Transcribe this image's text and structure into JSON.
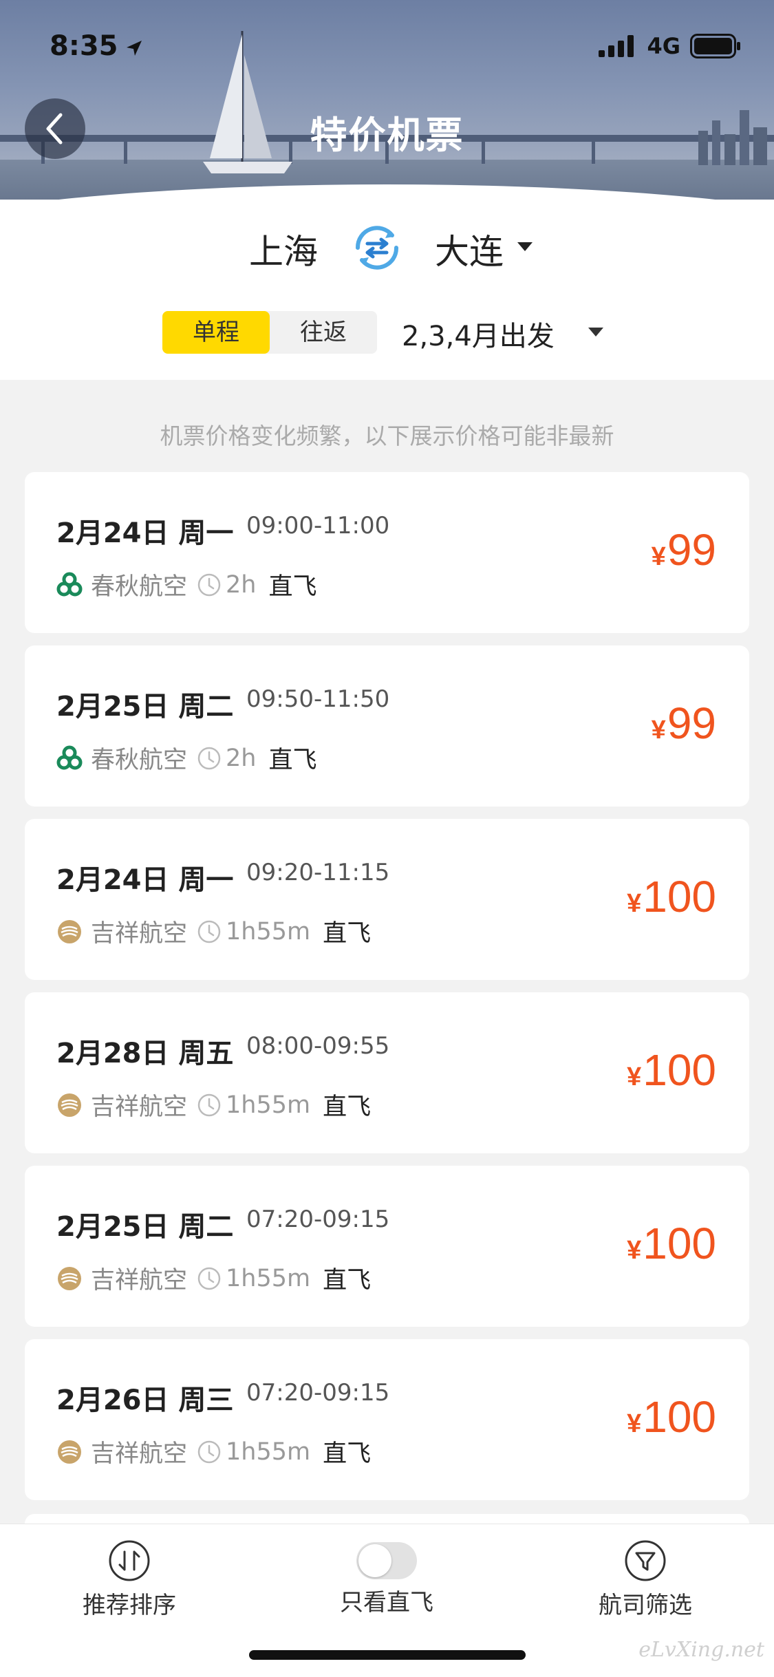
{
  "status_bar": {
    "time": "8:35",
    "network": "4G"
  },
  "header": {
    "title": "特价机票"
  },
  "route": {
    "from_city": "上海",
    "to_city": "大连"
  },
  "trip_type": {
    "one_way": "单程",
    "round_trip": "往返",
    "selected": "单程"
  },
  "departure_months": "2,3,4月出发",
  "notice": "机票价格变化频繁，以下展示价格可能非最新",
  "flights": [
    {
      "date": "2月24日 周一",
      "times": "09:00-11:00",
      "airline": "春秋航空",
      "duration": "2h",
      "type": "直飞",
      "currency": "¥",
      "price": "99"
    },
    {
      "date": "2月25日 周二",
      "times": "09:50-11:50",
      "airline": "春秋航空",
      "duration": "2h",
      "type": "直飞",
      "currency": "¥",
      "price": "99"
    },
    {
      "date": "2月24日 周一",
      "times": "09:20-11:15",
      "airline": "吉祥航空",
      "duration": "1h55m",
      "type": "直飞",
      "currency": "¥",
      "price": "100"
    },
    {
      "date": "2月28日 周五",
      "times": "08:00-09:55",
      "airline": "吉祥航空",
      "duration": "1h55m",
      "type": "直飞",
      "currency": "¥",
      "price": "100"
    },
    {
      "date": "2月25日 周二",
      "times": "07:20-09:15",
      "airline": "吉祥航空",
      "duration": "1h55m",
      "type": "直飞",
      "currency": "¥",
      "price": "100"
    },
    {
      "date": "2月26日 周三",
      "times": "07:20-09:15",
      "airline": "吉祥航空",
      "duration": "1h55m",
      "type": "直飞",
      "currency": "¥",
      "price": "100"
    }
  ],
  "bottom_bar": {
    "sort_label": "推荐排序",
    "direct_only_label": "只看直飞",
    "direct_only_on": false,
    "filter_label": "航司筛选"
  },
  "watermark": "eLvXing.net",
  "colors": {
    "accent_yellow": "#ffd900",
    "price_red": "#f0541e",
    "spring_green": "#1a8a5a",
    "juneyao_gold": "#c8a46a"
  },
  "icons": [
    "back-arrow-icon",
    "swap-icon",
    "caret-down-icon",
    "clock-icon",
    "spring-airlines-logo",
    "juneyao-airlines-logo",
    "sort-icon",
    "toggle-switch",
    "filter-icon",
    "signal-icon",
    "battery-icon",
    "location-arrow-icon"
  ]
}
